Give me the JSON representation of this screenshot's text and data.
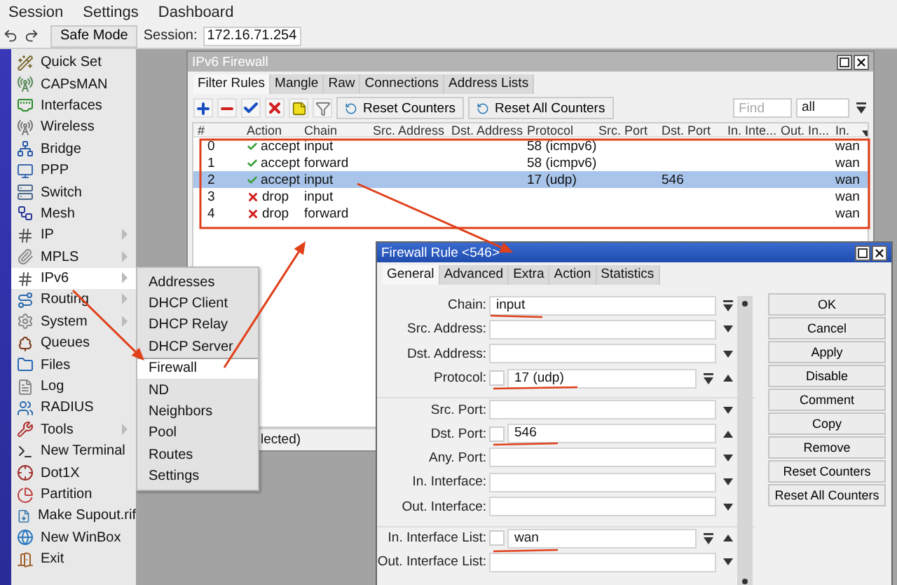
{
  "menu_bar": [
    "Session",
    "Settings",
    "Dashboard"
  ],
  "toolbar": {
    "safe_mode": "Safe Mode",
    "session_label": "Session:",
    "session_value": "172.16.71.254"
  },
  "sidebar": {
    "items": [
      {
        "label": "Quick Set",
        "submenu": false,
        "selected": false
      },
      {
        "label": "CAPsMAN",
        "submenu": false,
        "selected": false
      },
      {
        "label": "Interfaces",
        "submenu": false,
        "selected": false
      },
      {
        "label": "Wireless",
        "submenu": false,
        "selected": false
      },
      {
        "label": "Bridge",
        "submenu": false,
        "selected": false
      },
      {
        "label": "PPP",
        "submenu": false,
        "selected": false
      },
      {
        "label": "Switch",
        "submenu": false,
        "selected": false
      },
      {
        "label": "Mesh",
        "submenu": false,
        "selected": false
      },
      {
        "label": "IP",
        "submenu": true,
        "selected": false
      },
      {
        "label": "MPLS",
        "submenu": true,
        "selected": false
      },
      {
        "label": "IPv6",
        "submenu": true,
        "selected": true
      },
      {
        "label": "Routing",
        "submenu": true,
        "selected": false
      },
      {
        "label": "System",
        "submenu": true,
        "selected": false
      },
      {
        "label": "Queues",
        "submenu": false,
        "selected": false
      },
      {
        "label": "Files",
        "submenu": false,
        "selected": false
      },
      {
        "label": "Log",
        "submenu": false,
        "selected": false
      },
      {
        "label": "RADIUS",
        "submenu": false,
        "selected": false
      },
      {
        "label": "Tools",
        "submenu": true,
        "selected": false
      },
      {
        "label": "New Terminal",
        "submenu": false,
        "selected": false
      },
      {
        "label": "Dot1X",
        "submenu": false,
        "selected": false
      },
      {
        "label": "Partition",
        "submenu": false,
        "selected": false
      },
      {
        "label": "Make Supout.rif",
        "submenu": false,
        "selected": false
      },
      {
        "label": "New WinBox",
        "submenu": false,
        "selected": false
      },
      {
        "label": "Exit",
        "submenu": false,
        "selected": false
      }
    ]
  },
  "submenu": {
    "items": [
      {
        "label": "Addresses",
        "selected": false,
        "group_start": false
      },
      {
        "label": "DHCP Client",
        "selected": false,
        "group_start": false
      },
      {
        "label": "DHCP Relay",
        "selected": false,
        "group_start": false
      },
      {
        "label": "DHCP Server",
        "selected": false,
        "group_start": false
      },
      {
        "label": "Firewall",
        "selected": true,
        "group_start": true
      },
      {
        "label": "ND",
        "selected": false,
        "group_start": false
      },
      {
        "label": "Neighbors",
        "selected": false,
        "group_start": false
      },
      {
        "label": "Pool",
        "selected": false,
        "group_start": false
      },
      {
        "label": "Routes",
        "selected": false,
        "group_start": false
      },
      {
        "label": "Settings",
        "selected": false,
        "group_start": false
      }
    ]
  },
  "firewall_window": {
    "title": "IPv6 Firewall",
    "tabs": [
      {
        "label": "Filter Rules",
        "selected": true
      },
      {
        "label": "Mangle",
        "selected": false
      },
      {
        "label": "Raw",
        "selected": false
      },
      {
        "label": "Connections",
        "selected": false
      },
      {
        "label": "Address Lists",
        "selected": false
      }
    ],
    "buttons": [
      "Reset Counters",
      "Reset All Counters"
    ],
    "find": {
      "placeholder": "Find"
    },
    "filter": "all",
    "table": {
      "columns": [
        "#",
        "Action",
        "Chain",
        "Src. Address",
        "Dst. Address",
        "Protocol",
        "Src. Port",
        "Dst. Port",
        "In. Inte...",
        "Out. In...",
        "In."
      ],
      "rows": [
        {
          "num": "0",
          "kind": "accept",
          "action": "accept",
          "chain": "input",
          "protocol": "58 (icmpv6)",
          "in_interface": "wan",
          "selected": false
        },
        {
          "num": "1",
          "kind": "accept",
          "action": "accept",
          "chain": "forward",
          "protocol": "58 (icmpv6)",
          "in_interface": "wan",
          "selected": false
        },
        {
          "num": "2",
          "kind": "accept",
          "action": "accept",
          "chain": "input",
          "protocol": "17 (udp)",
          "dst_port": "546",
          "in_interface": "wan",
          "selected": true
        },
        {
          "num": "3",
          "kind": "drop",
          "action": "drop",
          "chain": "input",
          "in_interface": "wan",
          "selected": false
        },
        {
          "num": "4",
          "kind": "drop",
          "action": "drop",
          "chain": "forward",
          "in_interface": "wan",
          "selected": false
        }
      ]
    },
    "status": "lected)"
  },
  "rule_dialog": {
    "title": "Firewall Rule <546>",
    "tabs": [
      {
        "label": "General",
        "selected": true
      },
      {
        "label": "Advanced",
        "selected": false
      },
      {
        "label": "Extra",
        "selected": false
      },
      {
        "label": "Action",
        "selected": false
      },
      {
        "label": "Statistics",
        "selected": false
      }
    ],
    "fields": [
      {
        "label": "Chain:",
        "kind": "select",
        "value": "input",
        "group_start": false
      },
      {
        "label": "Src. Address:",
        "kind": "empty",
        "group_start": false
      },
      {
        "label": "Dst. Address:",
        "kind": "empty",
        "group_start": false
      },
      {
        "label": "Protocol:",
        "kind": "condition",
        "value": "17 (udp)",
        "checked": false,
        "list": true,
        "group_start": false
      },
      {
        "label": "Src. Port:",
        "kind": "empty",
        "group_start": true
      },
      {
        "label": "Dst. Port:",
        "kind": "condition",
        "value": "546",
        "checked": false,
        "list": false,
        "group_start": false
      },
      {
        "label": "Any. Port:",
        "kind": "empty",
        "group_start": false
      },
      {
        "label": "In. Interface:",
        "kind": "empty",
        "group_start": false
      },
      {
        "label": "Out. Interface:",
        "kind": "empty",
        "group_start": false
      },
      {
        "label": "In. Interface List:",
        "kind": "condition",
        "value": "wan",
        "checked": false,
        "list": true,
        "group_start": true
      },
      {
        "label": "Out. Interface List:",
        "kind": "empty",
        "group_start": false
      }
    ],
    "buttons": [
      "OK",
      "Cancel",
      "Apply",
      "Disable",
      "Comment",
      "Copy",
      "Remove",
      "Reset Counters",
      "Reset All Counters"
    ]
  }
}
